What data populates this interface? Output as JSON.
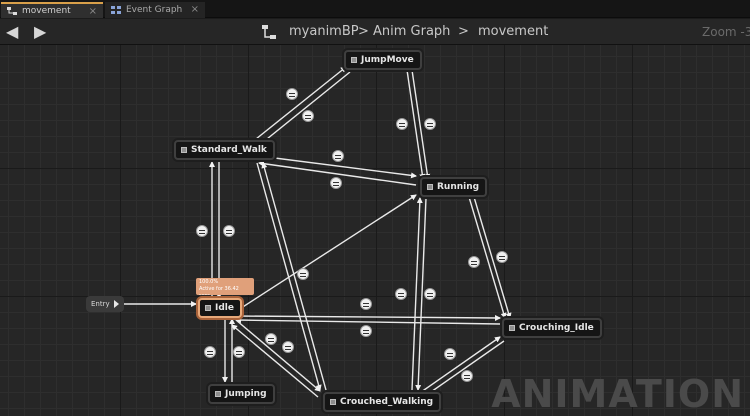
{
  "tabs": [
    {
      "label": "movement",
      "active": true
    },
    {
      "label": "Event Graph",
      "active": false
    }
  ],
  "toolbar": {
    "back_icon": "arrow-left-icon",
    "forward_icon": "arrow-right-icon"
  },
  "breadcrumb": {
    "blueprint": "myanimBP",
    "sep1": ">",
    "graph": "Anim Graph",
    "sep2": ">",
    "state_machine": "movement"
  },
  "zoom_label": "Zoom -3",
  "watermark": "ANIMATION",
  "entry_node": {
    "label": "Entry"
  },
  "states": [
    {
      "id": "jumpmove",
      "label": "JumpMove"
    },
    {
      "id": "standard_walk",
      "label": "Standard_Walk"
    },
    {
      "id": "running",
      "label": "Running"
    },
    {
      "id": "idle",
      "label": "Idle"
    },
    {
      "id": "crouching_idle",
      "label": "Crouching_Idle"
    },
    {
      "id": "jumping",
      "label": "Jumping"
    },
    {
      "id": "crouched_walking",
      "label": "Crouched_Walking"
    }
  ],
  "active_state_badge": {
    "line1": "100.0%",
    "line2": "Active for 36.42 secs"
  },
  "colors": {
    "active_state_border": "#e8a97a",
    "tab_accent": "#d9a04a"
  }
}
